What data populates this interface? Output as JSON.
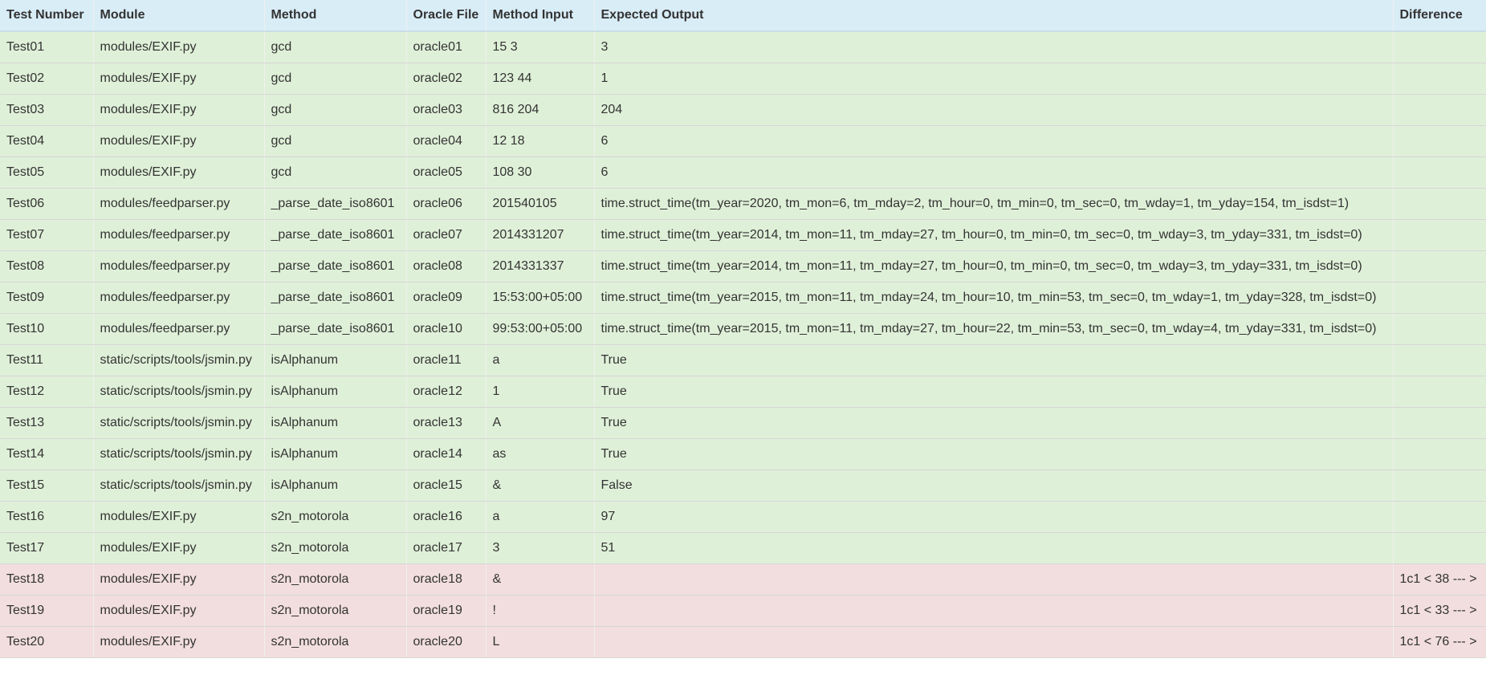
{
  "columns": [
    "Test Number",
    "Module",
    "Method",
    "Oracle File",
    "Method Input",
    "Expected Output",
    "Difference"
  ],
  "colors": {
    "header_bg": "#d9edf7",
    "pass_bg": "#dff0d8",
    "fail_bg": "#f2dede"
  },
  "rows": [
    {
      "status": "pass",
      "test": "Test01",
      "module": "modules/EXIF.py",
      "method": "gcd",
      "oracle": "oracle01",
      "input": "15 3",
      "expected": "3",
      "difference": ""
    },
    {
      "status": "pass",
      "test": "Test02",
      "module": "modules/EXIF.py",
      "method": "gcd",
      "oracle": "oracle02",
      "input": "123 44",
      "expected": "1",
      "difference": ""
    },
    {
      "status": "pass",
      "test": "Test03",
      "module": "modules/EXIF.py",
      "method": "gcd",
      "oracle": "oracle03",
      "input": "816 204",
      "expected": "204",
      "difference": ""
    },
    {
      "status": "pass",
      "test": "Test04",
      "module": "modules/EXIF.py",
      "method": "gcd",
      "oracle": "oracle04",
      "input": "12 18",
      "expected": "6",
      "difference": ""
    },
    {
      "status": "pass",
      "test": "Test05",
      "module": "modules/EXIF.py",
      "method": "gcd",
      "oracle": "oracle05",
      "input": "108 30",
      "expected": "6",
      "difference": ""
    },
    {
      "status": "pass",
      "test": "Test06",
      "module": "modules/feedparser.py",
      "method": "_parse_date_iso8601",
      "oracle": "oracle06",
      "input": "201540105",
      "expected": "time.struct_time(tm_year=2020, tm_mon=6, tm_mday=2, tm_hour=0, tm_min=0, tm_sec=0, tm_wday=1, tm_yday=154, tm_isdst=1)",
      "difference": ""
    },
    {
      "status": "pass",
      "test": "Test07",
      "module": "modules/feedparser.py",
      "method": "_parse_date_iso8601",
      "oracle": "oracle07",
      "input": "2014331207",
      "expected": "time.struct_time(tm_year=2014, tm_mon=11, tm_mday=27, tm_hour=0, tm_min=0, tm_sec=0, tm_wday=3, tm_yday=331, tm_isdst=0)",
      "difference": ""
    },
    {
      "status": "pass",
      "test": "Test08",
      "module": "modules/feedparser.py",
      "method": "_parse_date_iso8601",
      "oracle": "oracle08",
      "input": "2014331337",
      "expected": "time.struct_time(tm_year=2014, tm_mon=11, tm_mday=27, tm_hour=0, tm_min=0, tm_sec=0, tm_wday=3, tm_yday=331, tm_isdst=0)",
      "difference": ""
    },
    {
      "status": "pass",
      "test": "Test09",
      "module": "modules/feedparser.py",
      "method": "_parse_date_iso8601",
      "oracle": "oracle09",
      "input": "15:53:00+05:00",
      "expected": "time.struct_time(tm_year=2015, tm_mon=11, tm_mday=24, tm_hour=10, tm_min=53, tm_sec=0, tm_wday=1, tm_yday=328, tm_isdst=0)",
      "difference": ""
    },
    {
      "status": "pass",
      "test": "Test10",
      "module": "modules/feedparser.py",
      "method": "_parse_date_iso8601",
      "oracle": "oracle10",
      "input": "99:53:00+05:00",
      "expected": "time.struct_time(tm_year=2015, tm_mon=11, tm_mday=27, tm_hour=22, tm_min=53, tm_sec=0, tm_wday=4, tm_yday=331, tm_isdst=0)",
      "difference": ""
    },
    {
      "status": "pass",
      "test": "Test11",
      "module": "static/scripts/tools/jsmin.py",
      "method": "isAlphanum",
      "oracle": "oracle11",
      "input": "a",
      "expected": "True",
      "difference": ""
    },
    {
      "status": "pass",
      "test": "Test12",
      "module": "static/scripts/tools/jsmin.py",
      "method": "isAlphanum",
      "oracle": "oracle12",
      "input": "1",
      "expected": "True",
      "difference": ""
    },
    {
      "status": "pass",
      "test": "Test13",
      "module": "static/scripts/tools/jsmin.py",
      "method": "isAlphanum",
      "oracle": "oracle13",
      "input": "A",
      "expected": "True",
      "difference": ""
    },
    {
      "status": "pass",
      "test": "Test14",
      "module": "static/scripts/tools/jsmin.py",
      "method": "isAlphanum",
      "oracle": "oracle14",
      "input": "as",
      "expected": "True",
      "difference": ""
    },
    {
      "status": "pass",
      "test": "Test15",
      "module": "static/scripts/tools/jsmin.py",
      "method": "isAlphanum",
      "oracle": "oracle15",
      "input": "&",
      "expected": "False",
      "difference": ""
    },
    {
      "status": "pass",
      "test": "Test16",
      "module": "modules/EXIF.py",
      "method": "s2n_motorola",
      "oracle": "oracle16",
      "input": "a",
      "expected": "97",
      "difference": ""
    },
    {
      "status": "pass",
      "test": "Test17",
      "module": "modules/EXIF.py",
      "method": "s2n_motorola",
      "oracle": "oracle17",
      "input": "3",
      "expected": "51",
      "difference": ""
    },
    {
      "status": "fail",
      "test": "Test18",
      "module": "modules/EXIF.py",
      "method": "s2n_motorola",
      "oracle": "oracle18",
      "input": "&",
      "expected": "",
      "difference": "1c1 < 38 --- >"
    },
    {
      "status": "fail",
      "test": "Test19",
      "module": "modules/EXIF.py",
      "method": "s2n_motorola",
      "oracle": "oracle19",
      "input": "!",
      "expected": "",
      "difference": "1c1 < 33 --- >"
    },
    {
      "status": "fail",
      "test": "Test20",
      "module": "modules/EXIF.py",
      "method": "s2n_motorola",
      "oracle": "oracle20",
      "input": "L",
      "expected": "",
      "difference": "1c1 < 76 --- >"
    }
  ]
}
